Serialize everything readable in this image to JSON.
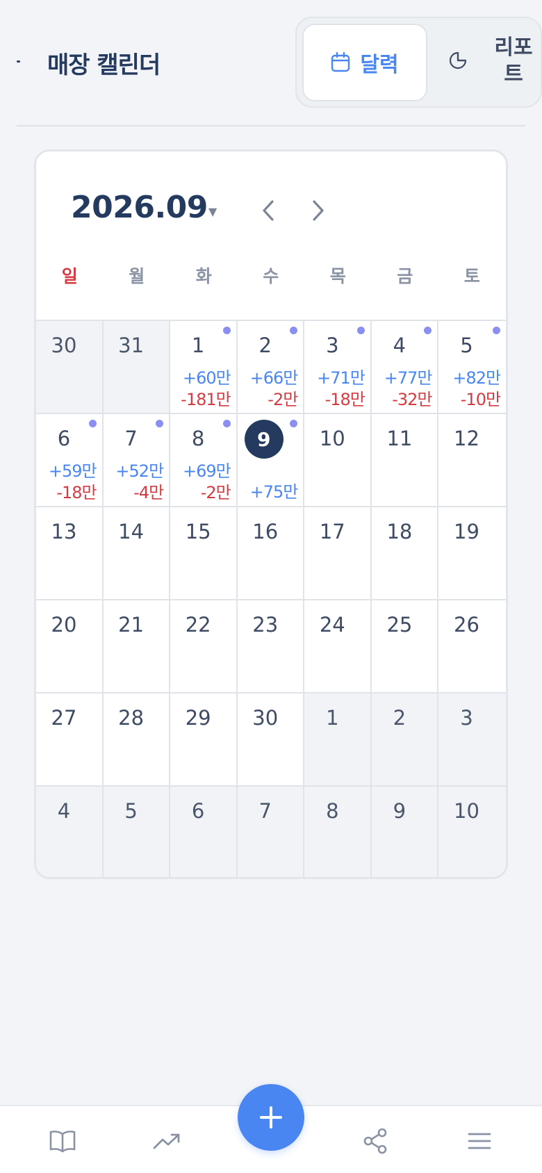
{
  "header": {
    "title": "매장 캘린더",
    "toggle_calendar": "달력",
    "toggle_report": "리포트"
  },
  "calendar": {
    "month": "2026.09",
    "weekdays": [
      "일",
      "월",
      "화",
      "수",
      "목",
      "금",
      "토"
    ],
    "today": "9",
    "weeks": [
      [
        {
          "day": "30",
          "muted": true
        },
        {
          "day": "31",
          "muted": true
        },
        {
          "day": "1",
          "mark": true,
          "inc": "+60만",
          "exp": "-181만"
        },
        {
          "day": "2",
          "mark": true,
          "inc": "+66만",
          "exp": "-2만"
        },
        {
          "day": "3",
          "mark": true,
          "inc": "+71만",
          "exp": "-18만"
        },
        {
          "day": "4",
          "mark": true,
          "inc": "+77만",
          "exp": "-32만"
        },
        {
          "day": "5",
          "mark": true,
          "inc": "+82만",
          "exp": "-10만"
        }
      ],
      [
        {
          "day": "6",
          "mark": true,
          "inc": "+59만",
          "exp": "-18만"
        },
        {
          "day": "7",
          "mark": true,
          "inc": "+52만",
          "exp": "-4만"
        },
        {
          "day": "8",
          "mark": true,
          "inc": "+69만",
          "exp": "-2만"
        },
        {
          "day": "9",
          "mark": true,
          "today": true,
          "inc": "+75만"
        },
        {
          "day": "10"
        },
        {
          "day": "11"
        },
        {
          "day": "12"
        }
      ],
      [
        {
          "day": "13"
        },
        {
          "day": "14"
        },
        {
          "day": "15"
        },
        {
          "day": "16"
        },
        {
          "day": "17"
        },
        {
          "day": "18"
        },
        {
          "day": "19"
        }
      ],
      [
        {
          "day": "20"
        },
        {
          "day": "21"
        },
        {
          "day": "22"
        },
        {
          "day": "23"
        },
        {
          "day": "24"
        },
        {
          "day": "25"
        },
        {
          "day": "26"
        }
      ],
      [
        {
          "day": "27"
        },
        {
          "day": "28"
        },
        {
          "day": "29"
        },
        {
          "day": "30"
        },
        {
          "day": "1",
          "muted": true
        },
        {
          "day": "2",
          "muted": true
        },
        {
          "day": "3",
          "muted": true
        }
      ],
      [
        {
          "day": "4",
          "muted": true
        },
        {
          "day": "5",
          "muted": true
        },
        {
          "day": "6",
          "muted": true
        },
        {
          "day": "7",
          "muted": true
        },
        {
          "day": "8",
          "muted": true
        },
        {
          "day": "9",
          "muted": true
        },
        {
          "day": "10",
          "muted": true
        }
      ]
    ]
  },
  "bottom_nav": {
    "items": [
      "book-icon",
      "trending-icon",
      "add-icon",
      "share-icon",
      "menu-icon"
    ]
  },
  "colors": {
    "accent": "#4a86f2",
    "navy": "#243a5e",
    "income": "#4a86f2",
    "expense": "#d43c43",
    "marker": "#8b8ff0"
  }
}
